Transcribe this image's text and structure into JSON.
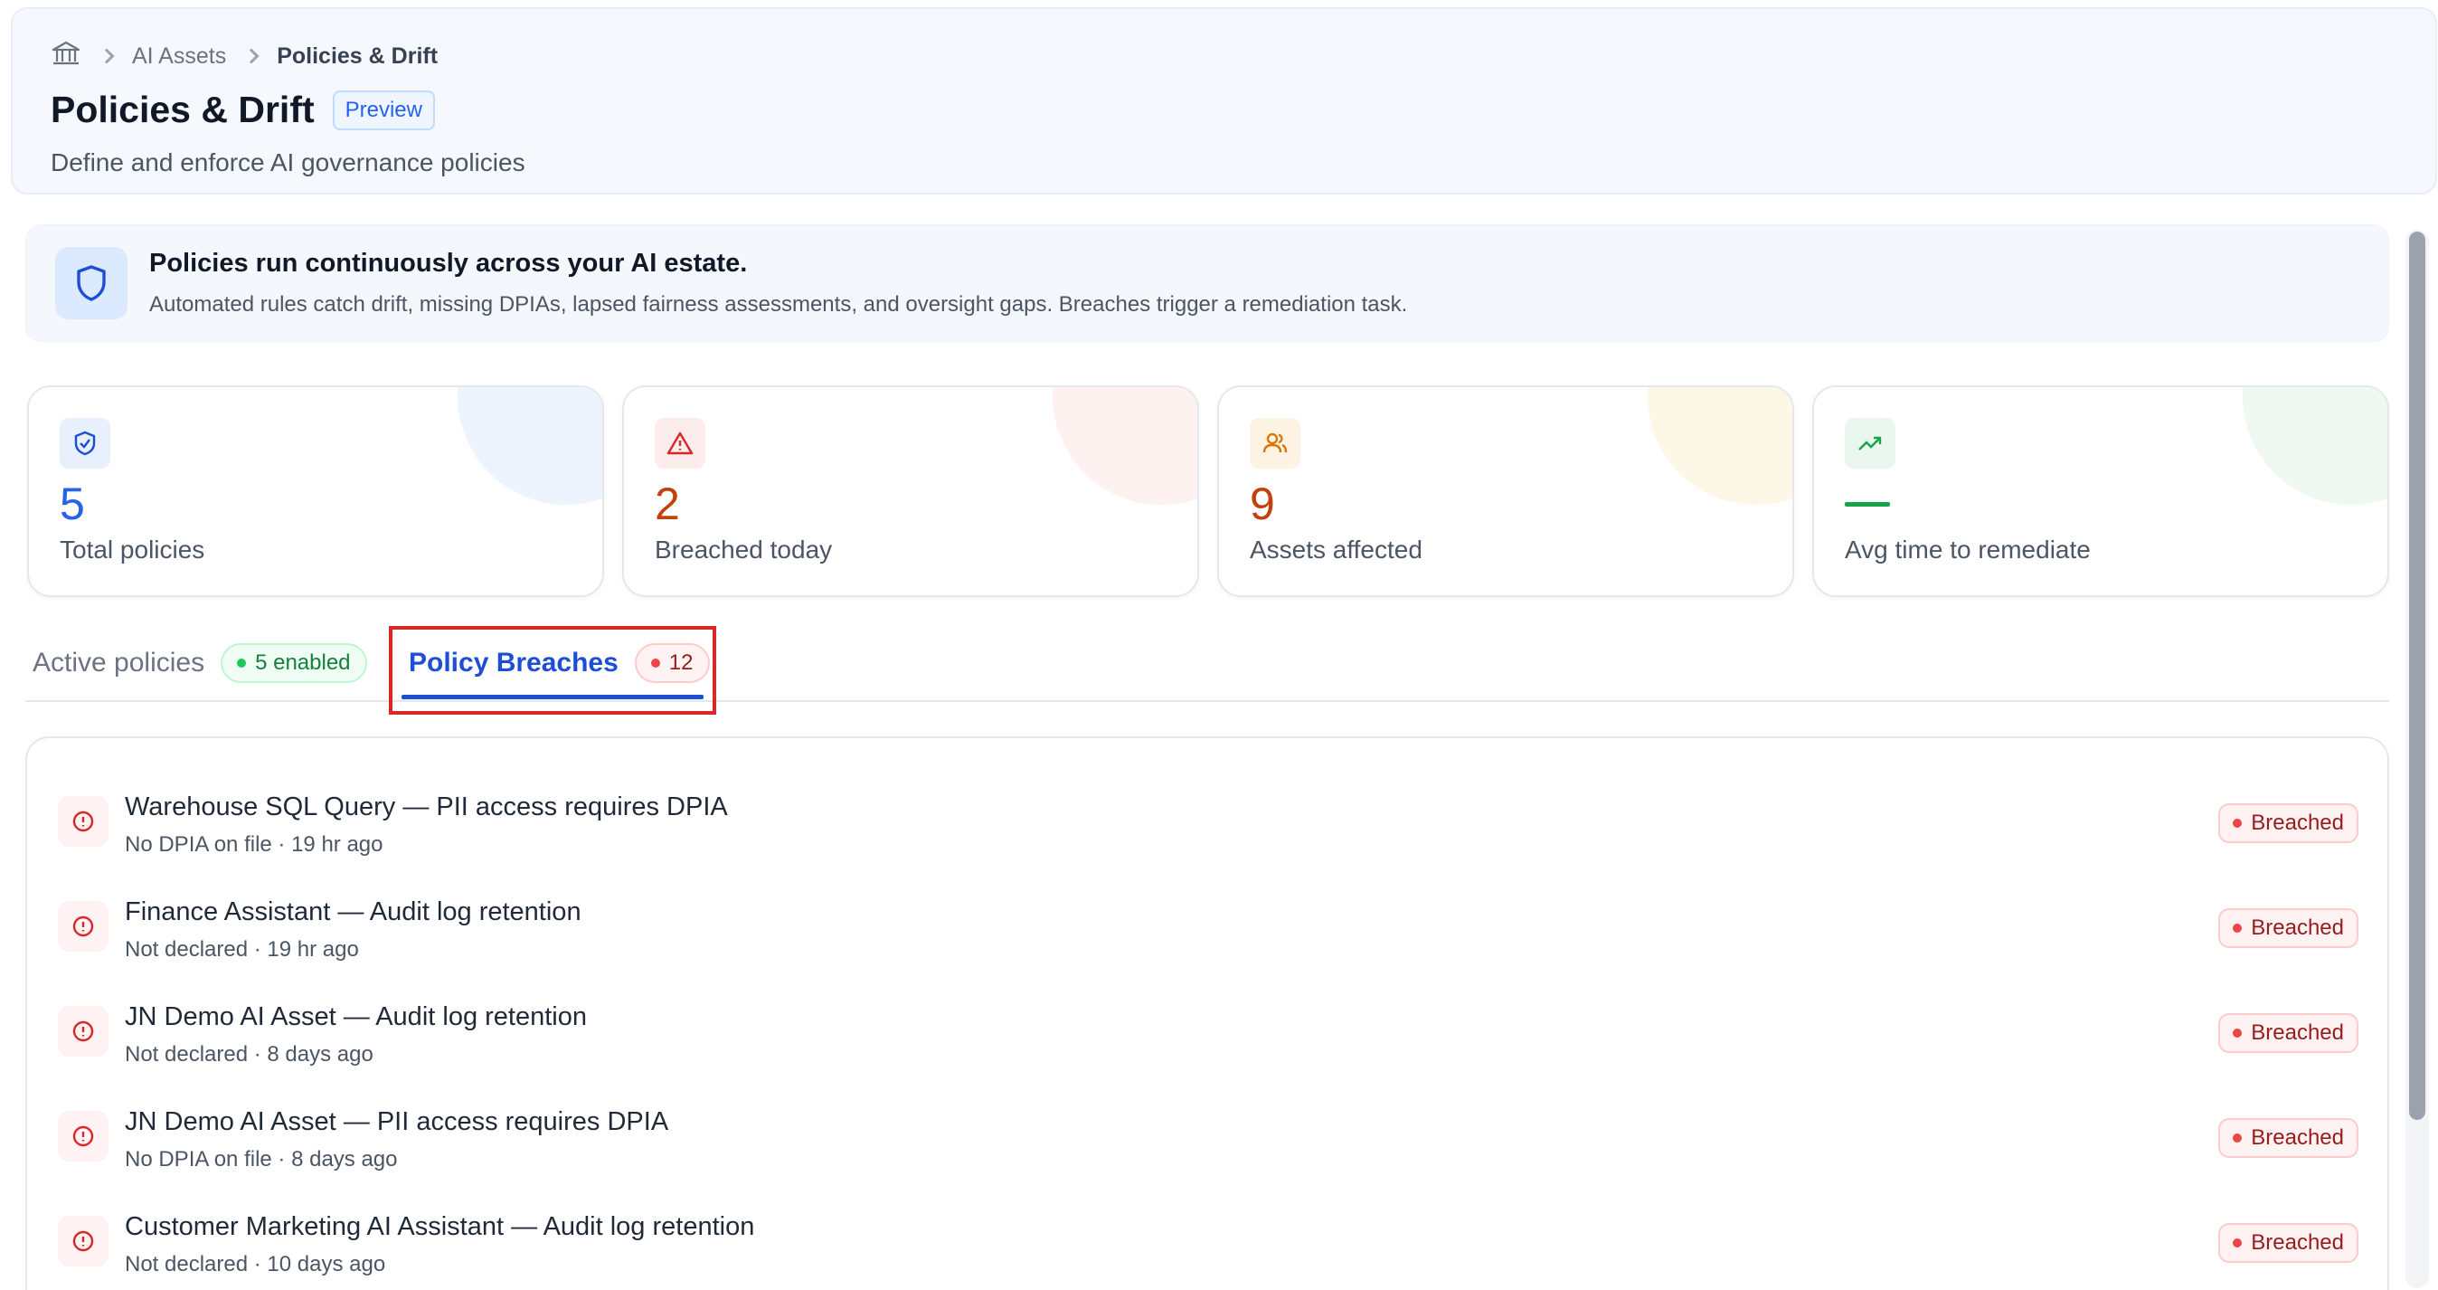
{
  "breadcrumb": {
    "items": [
      "AI Assets",
      "Policies & Drift"
    ]
  },
  "header": {
    "title": "Policies & Drift",
    "badge": "Preview",
    "subtitle": "Define and enforce AI governance policies"
  },
  "banner": {
    "title": "Policies run continuously across your AI estate.",
    "text": "Automated rules catch drift, missing DPIAs, lapsed fairness assessments, and oversight gaps. Breaches trigger a remediation task."
  },
  "stats": [
    {
      "value": "5",
      "label": "Total policies",
      "icon": "shield-check-icon",
      "color": "#2563eb"
    },
    {
      "value": "2",
      "label": "Breached today",
      "icon": "alert-triangle-icon",
      "color": "#dc2626"
    },
    {
      "value": "9",
      "label": "Assets affected",
      "icon": "users-icon",
      "color": "#d97706"
    },
    {
      "value": "—",
      "label": "Avg time to remediate",
      "icon": "trending-up-icon",
      "color": "#16a34a"
    }
  ],
  "tabs": [
    {
      "label": "Active policies",
      "badge": "5 enabled",
      "active": false
    },
    {
      "label": "Policy Breaches",
      "badge": "12",
      "active": true
    }
  ],
  "breaches": [
    {
      "title": "Warehouse SQL Query — PII access requires DPIA",
      "detail": "No DPIA on file · 19 hr ago",
      "status": "Breached"
    },
    {
      "title": "Finance Assistant — Audit log retention",
      "detail": "Not declared · 19 hr ago",
      "status": "Breached"
    },
    {
      "title": "JN Demo AI Asset — Audit log retention",
      "detail": "Not declared · 8 days ago",
      "status": "Breached"
    },
    {
      "title": "JN Demo AI Asset — PII access requires DPIA",
      "detail": "No DPIA on file · 8 days ago",
      "status": "Breached"
    },
    {
      "title": "Customer Marketing AI Assistant — Audit log retention",
      "detail": "Not declared · 10 days ago",
      "status": "Breached"
    }
  ]
}
